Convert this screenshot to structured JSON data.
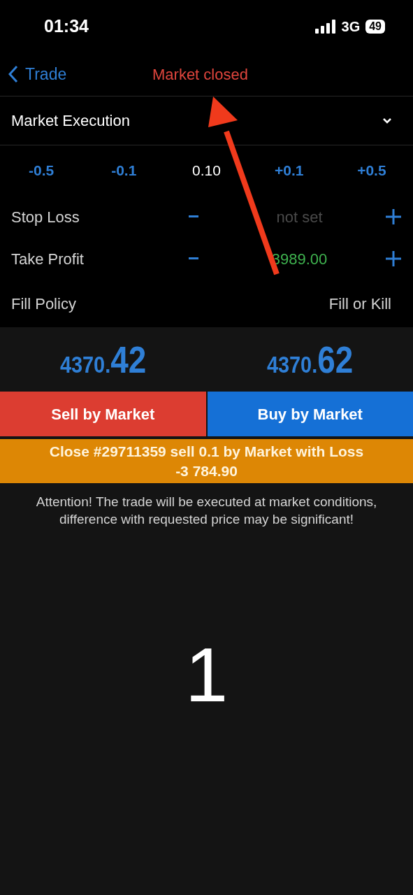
{
  "status_bar": {
    "time": "01:34",
    "network": "3G",
    "battery": "49"
  },
  "nav": {
    "back": "Trade",
    "title": "Market closed"
  },
  "order_type": {
    "label": "Market Execution"
  },
  "volume": {
    "steps": [
      "-0.5",
      "-0.1"
    ],
    "value": "0.10",
    "steps_up": [
      "+0.1",
      "+0.5"
    ]
  },
  "levels": [
    {
      "label": "Stop Loss",
      "value": "not set",
      "set": false
    },
    {
      "label": "Take Profit",
      "value": "3989.00",
      "set": true
    }
  ],
  "fill_policy": {
    "label": "Fill Policy",
    "value": "Fill or Kill"
  },
  "quotes": [
    {
      "main": "4370.",
      "big": "42"
    },
    {
      "main": "4370.",
      "big": "62"
    }
  ],
  "buttons": [
    {
      "label": "Sell by Market",
      "kind": "sell"
    },
    {
      "label": "Buy by Market",
      "kind": "buy"
    }
  ],
  "close_button": {
    "line1": "Close #29711359 sell 0.1 by Market with Loss",
    "line2": "-3 784.90"
  },
  "warning": "Attention! The trade will be executed at market conditions, difference with requested price may be significant!",
  "countdown": "1"
}
